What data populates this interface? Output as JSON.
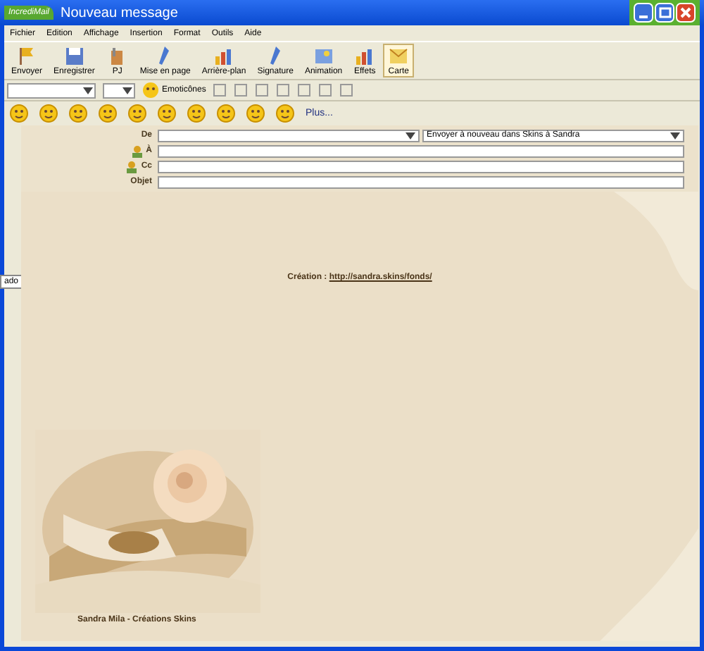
{
  "window": {
    "app_badge": "IncrediMail",
    "title": "Nouveau message"
  },
  "menu": [
    "Fichier",
    "Edition",
    "Affichage",
    "Insertion",
    "Format",
    "Outils",
    "Aide"
  ],
  "toolbar": [
    {
      "label": "Envoyer",
      "kind": "flag",
      "selected": false
    },
    {
      "label": "Enregistrer",
      "kind": "disk",
      "selected": false
    },
    {
      "label": "PJ",
      "kind": "clip",
      "selected": false
    },
    {
      "label": "Mise en page",
      "kind": "pen",
      "selected": false
    },
    {
      "label": "Arrière-plan",
      "kind": "chart",
      "selected": false
    },
    {
      "label": "Signature",
      "kind": "pen",
      "selected": false
    },
    {
      "label": "Animation",
      "kind": "pic",
      "selected": false
    },
    {
      "label": "Effets",
      "kind": "chart",
      "selected": false
    },
    {
      "label": "Carte",
      "kind": "card",
      "selected": true
    }
  ],
  "format_bar": {
    "emoticons_label": "Emoticônes"
  },
  "smileys": {
    "more": "Plus..."
  },
  "header": {
    "fields": [
      {
        "label": "De",
        "kind": "plain"
      },
      {
        "label": "À",
        "kind": "contact"
      },
      {
        "label": "Cc",
        "kind": "contact"
      },
      {
        "label": "Objet",
        "kind": "plain"
      }
    ],
    "stationery": "Envoyer à nouveau dans Skins à Sandra"
  },
  "side_tab": "ado",
  "body": {
    "credit_label": "Création :",
    "credit_link": "http://sandra.skins/fonds/",
    "signature": "Sandra Mila - Créations Skins"
  }
}
